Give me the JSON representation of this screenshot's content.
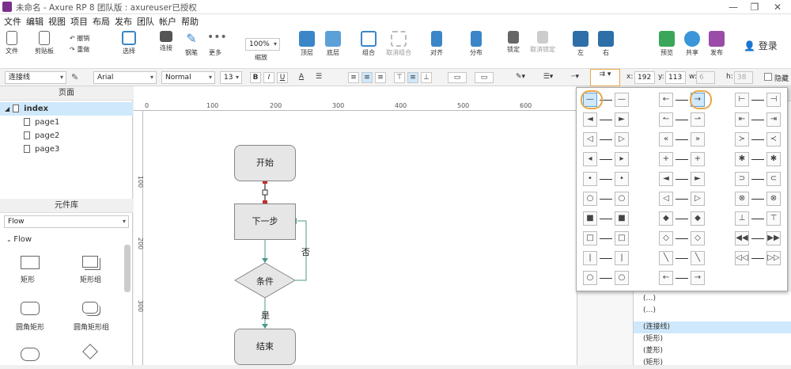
{
  "window": {
    "title": "未命名 - Axure RP 8 团队版 : axureuser已授权",
    "min": "—",
    "max": "❐",
    "close": "✕"
  },
  "menu": [
    "文件",
    "编辑",
    "视图",
    "项目",
    "布局",
    "发布",
    "团队",
    "帐户",
    "帮助"
  ],
  "toolbar": {
    "file": "文件",
    "clipboard": "剪贴板",
    "undo": "撤销",
    "redo": "重做",
    "select": "选择",
    "connect": "连接",
    "pen": "钢笔",
    "more": "更多",
    "zoom_value": "100%",
    "zoom_label": "缩放",
    "top": "顶层",
    "bottom": "底层",
    "group": "组合",
    "ungroup": "取消组合",
    "align": "对齐",
    "distribute": "分布",
    "lock": "锁定",
    "unlock": "取消锁定",
    "left": "左",
    "right": "右",
    "preview": "预览",
    "share": "共享",
    "publish": "发布",
    "login": "登录"
  },
  "format": {
    "style": "连接线",
    "font": "Arial",
    "weight": "Normal",
    "size": "13",
    "bold": "B",
    "italic": "I",
    "underline": "U",
    "fontcolor": "A",
    "x_label": "x:",
    "x": "192",
    "y_label": "y:",
    "y": "113",
    "w_label": "w:",
    "w": "6",
    "h_label": "h:",
    "h": "38",
    "hide": "隐藏"
  },
  "pages": {
    "header": "页面",
    "items": [
      {
        "label": "index",
        "level": 0
      },
      {
        "label": "page1",
        "level": 1
      },
      {
        "label": "page2",
        "level": 1
      },
      {
        "label": "page3",
        "level": 1
      }
    ]
  },
  "library": {
    "header": "元件库",
    "selected": "Flow",
    "section": "Flow",
    "items": [
      "矩形",
      "矩形组",
      "圆角矩形",
      "圆角矩形组"
    ]
  },
  "canvas": {
    "tab": "index",
    "ruler_h": [
      "0",
      "100",
      "200",
      "300",
      "400",
      "500",
      "600"
    ],
    "ruler_v": [
      "100",
      "200",
      "300"
    ],
    "start": "开始",
    "next": "下一步",
    "condition": "条件",
    "end": "结束",
    "no": "否",
    "yes": "是"
  },
  "arrow_styles": {
    "rows": [
      [
        "—",
        "—",
        "←",
        "→",
        "⊢",
        "⊣"
      ],
      [
        "◄",
        "►",
        "↼",
        "⇀",
        "⇤",
        "⇥"
      ],
      [
        "◁",
        "▷",
        "«",
        "»",
        "≻",
        "≺"
      ],
      [
        "◂",
        "▸",
        "+",
        "+",
        "✱",
        "✱"
      ],
      [
        "•",
        "•",
        "◄",
        "►",
        "⊃",
        "⊂"
      ],
      [
        "○",
        "○",
        "◁",
        "▷",
        "⊗",
        "⊗"
      ],
      [
        "■",
        "■",
        "◆",
        "◆",
        "⊥",
        "⊤"
      ],
      [
        "□",
        "□",
        "◇",
        "◇",
        "◀◀",
        "▶▶"
      ],
      [
        "|",
        "|",
        "╲",
        "╲",
        "◁◁",
        "▷▷"
      ],
      [
        "○",
        "○",
        "←",
        "→",
        "",
        ""
      ]
    ]
  },
  "layers": {
    "items": [
      "(…)",
      "(…)",
      "(连接线)",
      "(矩形)",
      "(菱形)",
      "(矩形)"
    ]
  }
}
